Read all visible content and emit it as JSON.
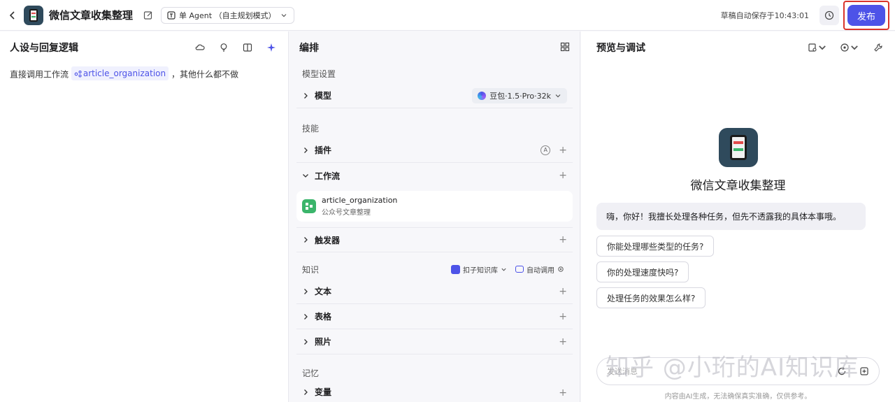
{
  "topbar": {
    "app_title": "微信文章收集整理",
    "mode_label": "单 Agent （自主规划模式）",
    "save_status": "草稿自动保存于10:43:01",
    "publish_label": "发布"
  },
  "left": {
    "title": "人设与回复逻辑",
    "prompt_prefix": "直接调用工作流",
    "prompt_var": "article_organization",
    "prompt_suffix": "，其他什么都不做"
  },
  "mid": {
    "title": "编排",
    "model_section": "模型设置",
    "model_row": "模型",
    "model_value": "豆包·1.5·Pro·32k",
    "skills_section": "技能",
    "plugins_row": "插件",
    "plugins_badge": "A",
    "workflow_row": "工作流",
    "workflow_name": "article_organization",
    "workflow_desc": "公众号文章整理",
    "trigger_row": "触发器",
    "knowledge_section": "知识",
    "kb_source": "扣子知识库",
    "kb_mode": "自动调用",
    "text_row": "文本",
    "table_row": "表格",
    "photo_row": "照片",
    "memory_section": "记忆",
    "variable_row": "变量",
    "plus": "+"
  },
  "right": {
    "title": "预览与调试",
    "bot_name": "微信文章收集整理",
    "greeting": "嗨，你好！我擅长处理各种任务，但先不透露我的具体本事哦。",
    "suggestions": [
      "你能处理哪些类型的任务?",
      "你的处理速度快吗?",
      "处理任务的效果怎么样?"
    ],
    "input_placeholder": "发送消息",
    "disclaimer": "内容由AI生成，无法确保真实准确，仅供参考。",
    "watermark": "知乎 @小珩的AI知识库"
  },
  "colors": {
    "accent": "#4d53e8",
    "highlight_border": "#d9342b",
    "workflow_icon": "#3bb56b"
  }
}
